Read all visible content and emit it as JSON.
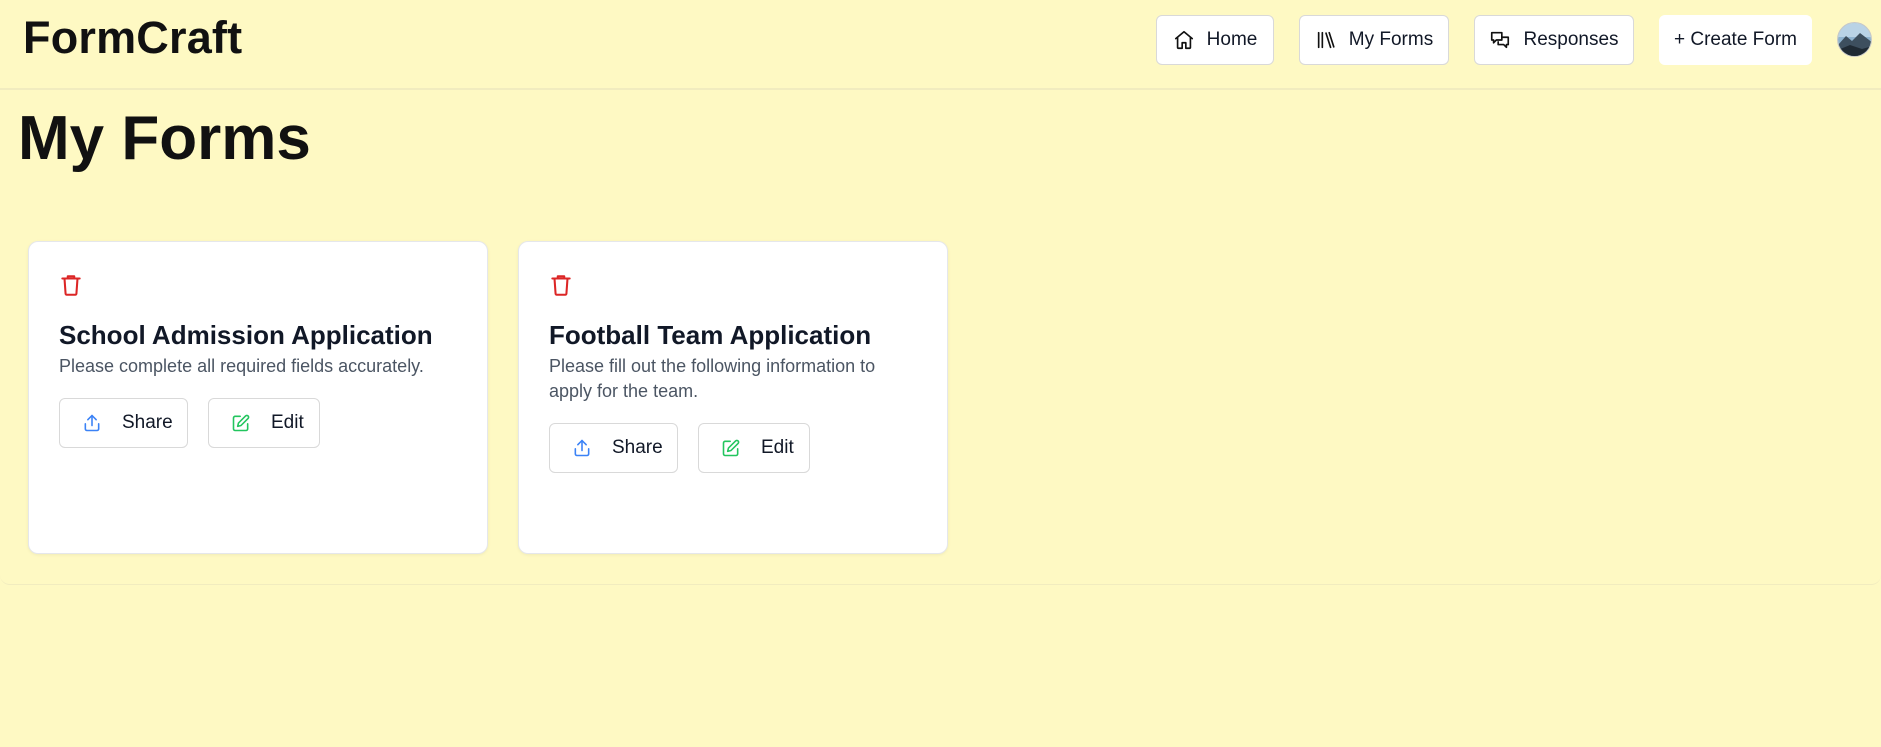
{
  "header": {
    "brand": "FormCraft",
    "nav": [
      {
        "label": "Home",
        "icon": "home-icon"
      },
      {
        "label": "My Forms",
        "icon": "library-icon"
      },
      {
        "label": "Responses",
        "icon": "chat-icon"
      },
      {
        "label": "+ Create Form"
      }
    ],
    "avatar": "user-avatar"
  },
  "page": {
    "title": "My Forms"
  },
  "forms": [
    {
      "title": "School Admission Application",
      "description": "Please complete all required fields accurately.",
      "share_label": "Share",
      "edit_label": "Edit"
    },
    {
      "title": "Football Team Application",
      "description": "Please fill out the following information to apply for the team.",
      "share_label": "Share",
      "edit_label": "Edit"
    }
  ],
  "colors": {
    "background": "#fef9c3",
    "delete": "#dc2626",
    "share": "#3b82f6",
    "edit": "#22c55e"
  }
}
